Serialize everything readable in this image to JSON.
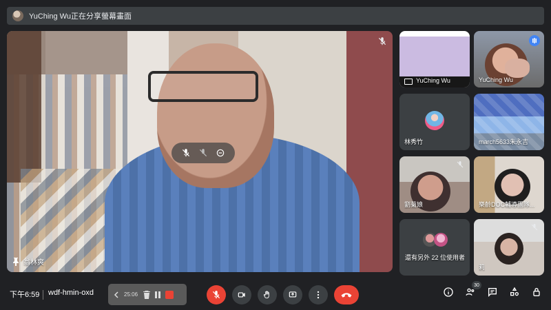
{
  "banner": {
    "presenter_avatar_icon": "avatar-icon",
    "text": "YuChing Wu正在分享螢幕畫面"
  },
  "main_speaker": {
    "name": "翁林爽",
    "pin_icon": "pin-icon",
    "muted_icon": "mic-muted-icon",
    "controls": [
      {
        "icon": "mic-off-icon"
      },
      {
        "icon": "mic-muted-icon"
      },
      {
        "icon": "remove-circle-icon"
      }
    ]
  },
  "tiles": [
    {
      "name": "YuChing Wu",
      "type": "screen-share"
    },
    {
      "name": "YuChing Wu",
      "type": "video"
    },
    {
      "name": "林秀竹",
      "type": "avatar"
    },
    {
      "name": "march5633朱永吉",
      "type": "video"
    },
    {
      "name": "劉菊娘",
      "type": "video"
    },
    {
      "name": "樂齡DOC輔導團隊...",
      "type": "video"
    },
    {
      "name": "還有另外 22 位使用者",
      "type": "overflow"
    },
    {
      "name": "莉",
      "type": "video"
    }
  ],
  "footer": {
    "time": "下午6:59",
    "meeting_code": "wdf-hmin-oxd",
    "recorder": {
      "elapsed": "25:06"
    },
    "participant_count": "30"
  },
  "icons": {
    "controls": [
      "mic-off-icon",
      "camera-icon",
      "raise-hand-icon",
      "present-icon",
      "more-vert-icon",
      "end-call-icon"
    ],
    "right_controls": [
      "info-icon",
      "people-icon",
      "chat-icon",
      "activities-icon",
      "host-controls-icon"
    ]
  }
}
